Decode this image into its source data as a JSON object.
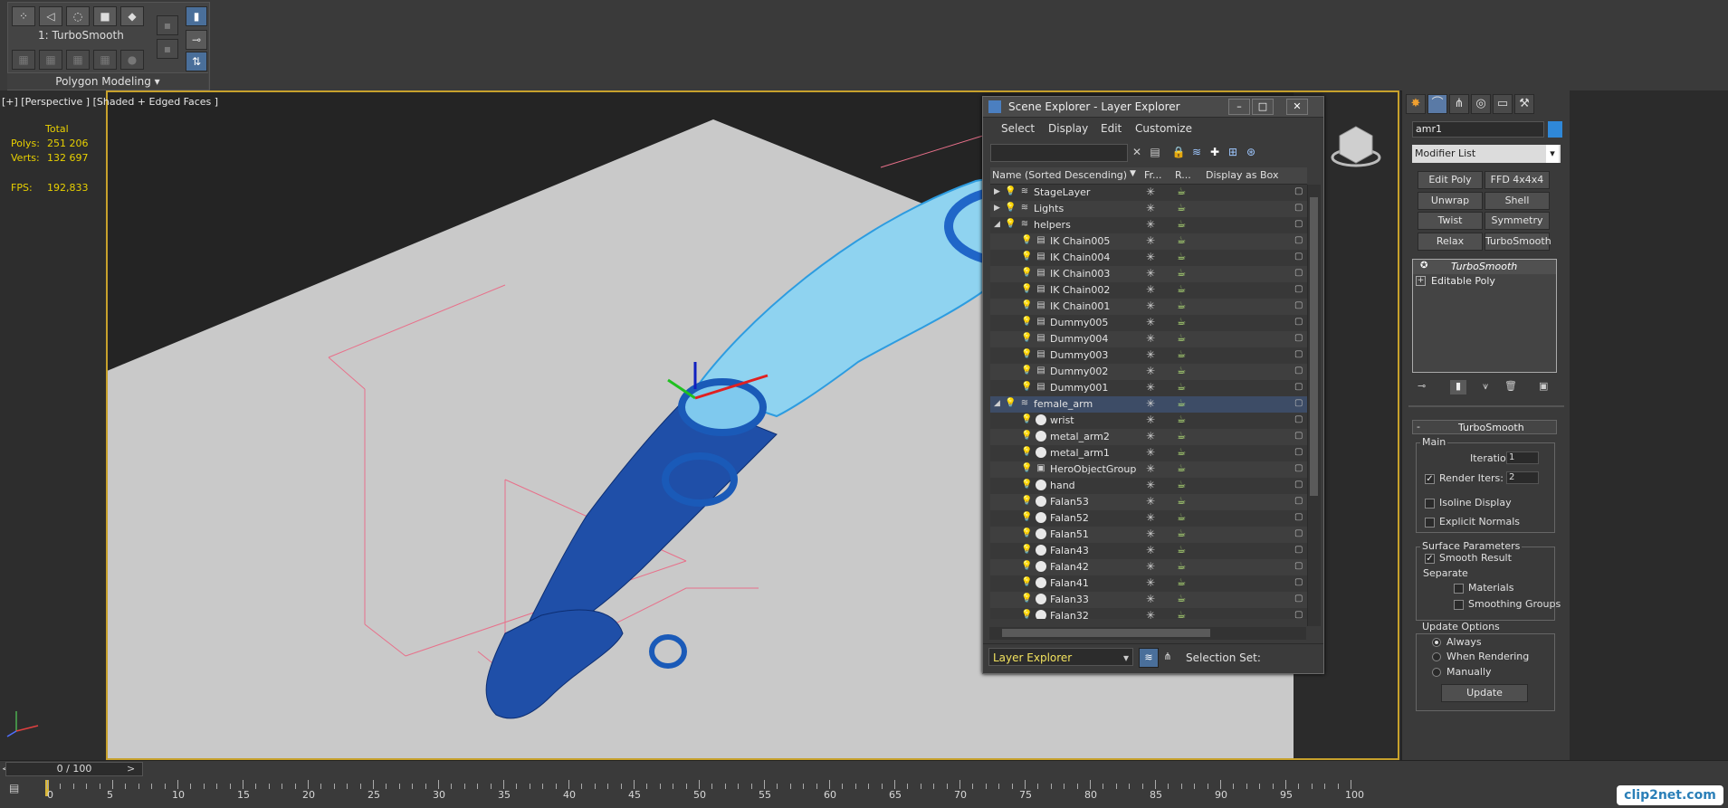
{
  "ribbon": {
    "modifier_name": "1: TurboSmooth",
    "polygon_modeling": "Polygon Modeling"
  },
  "viewport": {
    "label": "[+] [Perspective ] [Shaded + Edged Faces ]",
    "stats": {
      "total_label": "Total",
      "polys_label": "Polys:",
      "polys_value": "251 206",
      "verts_label": "Verts:",
      "verts_value": "132 697",
      "fps_label": "FPS:",
      "fps_value": "192,833"
    }
  },
  "scene_explorer": {
    "title": "Scene Explorer - Layer Explorer",
    "menu": [
      "Select",
      "Display",
      "Edit",
      "Customize"
    ],
    "columns": {
      "name": "Name (Sorted Descending)",
      "frozen": "Fr...",
      "render": "R...",
      "display_box": "Display as Box"
    },
    "rows": [
      {
        "name": "StageLayer",
        "level": 0,
        "kind": "layer",
        "expand": "collapsed"
      },
      {
        "name": "Lights",
        "level": 0,
        "kind": "layer",
        "expand": "collapsed"
      },
      {
        "name": "helpers",
        "level": 0,
        "kind": "layer",
        "expand": "expanded"
      },
      {
        "name": "IK Chain005",
        "level": 1,
        "kind": "helper"
      },
      {
        "name": "IK Chain004",
        "level": 1,
        "kind": "helper"
      },
      {
        "name": "IK Chain003",
        "level": 1,
        "kind": "helper"
      },
      {
        "name": "IK Chain002",
        "level": 1,
        "kind": "helper"
      },
      {
        "name": "IK Chain001",
        "level": 1,
        "kind": "helper"
      },
      {
        "name": "Dummy005",
        "level": 1,
        "kind": "helper"
      },
      {
        "name": "Dummy004",
        "level": 1,
        "kind": "helper"
      },
      {
        "name": "Dummy003",
        "level": 1,
        "kind": "helper"
      },
      {
        "name": "Dummy002",
        "level": 1,
        "kind": "helper"
      },
      {
        "name": "Dummy001",
        "level": 1,
        "kind": "helper"
      },
      {
        "name": "female_arm",
        "level": 0,
        "kind": "layer",
        "expand": "expanded",
        "selected": true
      },
      {
        "name": "wrist",
        "level": 1,
        "kind": "object"
      },
      {
        "name": "metal_arm2",
        "level": 1,
        "kind": "object"
      },
      {
        "name": "metal_arm1",
        "level": 1,
        "kind": "object"
      },
      {
        "name": "HeroObjectGroup",
        "level": 1,
        "kind": "group"
      },
      {
        "name": "hand",
        "level": 1,
        "kind": "object"
      },
      {
        "name": "Falan53",
        "level": 1,
        "kind": "object"
      },
      {
        "name": "Falan52",
        "level": 1,
        "kind": "object"
      },
      {
        "name": "Falan51",
        "level": 1,
        "kind": "object"
      },
      {
        "name": "Falan43",
        "level": 1,
        "kind": "object"
      },
      {
        "name": "Falan42",
        "level": 1,
        "kind": "object"
      },
      {
        "name": "Falan41",
        "level": 1,
        "kind": "object"
      },
      {
        "name": "Falan33",
        "level": 1,
        "kind": "object"
      },
      {
        "name": "Falan32",
        "level": 1,
        "kind": "object"
      }
    ],
    "explorer_dropdown": "Layer Explorer",
    "selection_set_label": "Selection Set:"
  },
  "command_panel": {
    "object_name": "amr1",
    "modifier_list": "Modifier List",
    "buttons": [
      "Edit Poly",
      "FFD 4x4x4",
      "Unwrap UVW",
      "Shell",
      "Twist",
      "Symmetry",
      "Relax",
      "TurboSmooth"
    ],
    "stack": [
      "TurboSmooth",
      "Editable Poly"
    ],
    "rollout_title": "TurboSmooth",
    "main_group": "Main",
    "iterations_label": "Iterations:",
    "iterations_value": "1",
    "render_iters_label": "Render Iters:",
    "render_iters_value": "2",
    "isoline_display": "Isoline Display",
    "explicit_normals": "Explicit Normals",
    "surface_params": "Surface Parameters",
    "smooth_result": "Smooth Result",
    "separate": "Separate",
    "materials": "Materials",
    "smoothing_groups": "Smoothing Groups",
    "update_options": "Update Options",
    "always": "Always",
    "when_rendering": "When Rendering",
    "manually": "Manually",
    "update": "Update"
  },
  "timeline": {
    "slider_text": "0 / 100",
    "ticks": [
      "0",
      "5",
      "10",
      "15",
      "20",
      "25",
      "30",
      "35",
      "40",
      "45",
      "50",
      "55",
      "60",
      "65",
      "70",
      "75",
      "80",
      "85",
      "90",
      "95",
      "100"
    ]
  },
  "watermark": "clip2net.com"
}
